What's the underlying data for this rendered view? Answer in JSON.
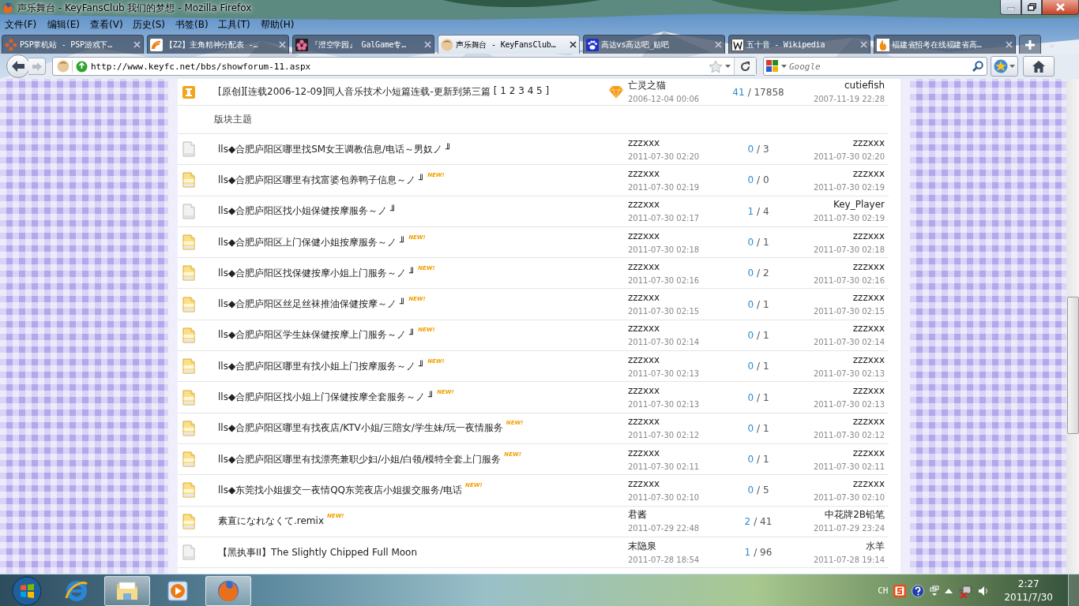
{
  "window": {
    "title": "声乐舞台 - KeyFansClub 我们的梦想 - Mozilla Firefox"
  },
  "menu": [
    "文件(F)",
    "编辑(E)",
    "查看(V)",
    "历史(S)",
    "书签(B)",
    "工具(T)",
    "帮助(H)"
  ],
  "tabs": [
    {
      "label": "PSP掌机站 - PSP游戏下…",
      "selected": false
    },
    {
      "label": "【Z2】主角精神分配表 -…",
      "selected": false
    },
    {
      "label": "『澄空学园』 GalGame专…",
      "selected": false
    },
    {
      "label": "声乐舞台 - KeyFansClub…",
      "selected": true
    },
    {
      "label": "高达vs高达吧_贴吧",
      "selected": false
    },
    {
      "label": "五十音 - Wikipedia",
      "selected": false
    },
    {
      "label": "福建省招考在线福建省高…",
      "selected": false
    }
  ],
  "navigation": {
    "url": "http://www.keyfc.net/bbs/showforum-11.aspx",
    "search_placeholder": "Google"
  },
  "forum": {
    "pinned": {
      "title": "[原创][连载2006-12-09]同人音乐技术小短篇连载-更新到第三篇",
      "pages": "[ 1 2 3 4 5 ]",
      "author": "亡灵之猫",
      "date": "2006-12-04 00:06",
      "replies": "41",
      "views": "/ 17858",
      "last_poster": "cutiefish",
      "last_date": "2007-11-19 22:28"
    },
    "section_label": "版块主题",
    "threads": [
      {
        "title": "lls◆合肥庐阳区哪里找SM女王调教信息/电话～男奴ノ ╜",
        "unread": false,
        "author": "zzzxxx",
        "date": "2011-07-30 02:20",
        "replies": "0",
        "views": "/ 3",
        "last_poster": "zzzxxx",
        "last_date": "2011-07-30 02:20"
      },
      {
        "title": "lls◆合肥庐阳区哪里有找富婆包养鸭子信息～ノ ╜",
        "badge": "NEW!",
        "unread": true,
        "author": "zzzxxx",
        "date": "2011-07-30 02:19",
        "replies": "0",
        "views": "/ 0",
        "last_poster": "zzzxxx",
        "last_date": "2011-07-30 02:19"
      },
      {
        "title": "lls◆合肥庐阳区找小姐保健按摩服务～ノ ╜",
        "unread": false,
        "author": "zzzxxx",
        "date": "2011-07-30 02:17",
        "replies": "1",
        "views": "/ 4",
        "last_poster": "Key_Player",
        "last_date": "2011-07-30 02:19"
      },
      {
        "title": "lls◆合肥庐阳区上门保健小姐按摩服务～ノ ╜",
        "badge": "NEW!",
        "unread": true,
        "author": "zzzxxx",
        "date": "2011-07-30 02:18",
        "replies": "0",
        "views": "/ 1",
        "last_poster": "zzzxxx",
        "last_date": "2011-07-30 02:18"
      },
      {
        "title": "lls◆合肥庐阳区找保健按摩小姐上门服务～ノ ╜",
        "badge": "NEW!",
        "unread": true,
        "author": "zzzxxx",
        "date": "2011-07-30 02:16",
        "replies": "0",
        "views": "/ 2",
        "last_poster": "zzzxxx",
        "last_date": "2011-07-30 02:16"
      },
      {
        "title": "lls◆合肥庐阳区丝足丝袜推油保健按摩～ノ ╜",
        "badge": "NEW!",
        "unread": true,
        "author": "zzzxxx",
        "date": "2011-07-30 02:15",
        "replies": "0",
        "views": "/ 1",
        "last_poster": "zzzxxx",
        "last_date": "2011-07-30 02:15"
      },
      {
        "title": "lls◆合肥庐阳区学生妹保健按摩上门服务～ノ ╜",
        "badge": "NEW!",
        "unread": true,
        "author": "zzzxxx",
        "date": "2011-07-30 02:14",
        "replies": "0",
        "views": "/ 1",
        "last_poster": "zzzxxx",
        "last_date": "2011-07-30 02:14"
      },
      {
        "title": "lls◆合肥庐阳区哪里有找小姐上门按摩服务～ノ ╜",
        "badge": "NEW!",
        "unread": true,
        "author": "zzzxxx",
        "date": "2011-07-30 02:13",
        "replies": "0",
        "views": "/ 1",
        "last_poster": "zzzxxx",
        "last_date": "2011-07-30 02:13"
      },
      {
        "title": "lls◆合肥庐阳区找小姐上门保健按摩全套服务～ノ ╜",
        "badge": "NEW!",
        "unread": true,
        "author": "zzzxxx",
        "date": "2011-07-30 02:13",
        "replies": "0",
        "views": "/ 1",
        "last_poster": "zzzxxx",
        "last_date": "2011-07-30 02:13"
      },
      {
        "title": "lls◆合肥庐阳区哪里有找夜店/KTV小姐/三陪女/学生妹/玩一夜情服务",
        "badge": "NEW!",
        "unread": true,
        "author": "zzzxxx",
        "date": "2011-07-30 02:12",
        "replies": "0",
        "views": "/ 1",
        "last_poster": "zzzxxx",
        "last_date": "2011-07-30 02:12"
      },
      {
        "title": "lls◆合肥庐阳区哪里有找漂亮兼职少妇/小姐/白领/模特全套上门服务",
        "badge": "NEW!",
        "unread": true,
        "author": "zzzxxx",
        "date": "2011-07-30 02:11",
        "replies": "0",
        "views": "/ 1",
        "last_poster": "zzzxxx",
        "last_date": "2011-07-30 02:11"
      },
      {
        "title": "lls◆东莞找小姐援交一夜情QQ东莞夜店小姐援交服务/电话",
        "badge": "NEW!",
        "unread": true,
        "author": "zzzxxx",
        "date": "2011-07-30 02:10",
        "replies": "0",
        "views": "/ 5",
        "last_poster": "zzzxxx",
        "last_date": "2011-07-30 02:10"
      },
      {
        "title": "素直になれなくて.remix",
        "badge": "NEW!",
        "unread": true,
        "author": "君酱",
        "date": "2011-07-29 22:48",
        "replies": "2",
        "views": "/ 41",
        "last_poster": "中花牌2B铅笔",
        "last_date": "2011-07-29 23:24"
      },
      {
        "title": "【黑执事II】The Slightly Chipped Full Moon",
        "unread": false,
        "author": "末隐泉",
        "date": "2011-07-28 18:54",
        "replies": "1",
        "views": "/ 96",
        "last_poster": "水羊",
        "last_date": "2011-07-28 19:14"
      }
    ]
  },
  "taskbar": {
    "apps": [
      {
        "running": false
      },
      {
        "running": true
      },
      {
        "running": false
      },
      {
        "running": true
      }
    ],
    "language": "CH",
    "time": "2:27",
    "date": "2011/7/30"
  }
}
